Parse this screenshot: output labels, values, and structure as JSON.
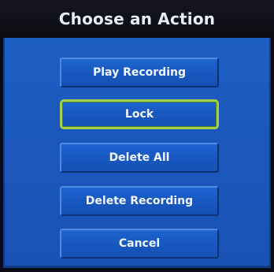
{
  "dialog": {
    "title": "Choose an Action"
  },
  "actions": [
    {
      "label": "Play Recording"
    },
    {
      "label": "Lock",
      "focused": true
    },
    {
      "label": "Delete All"
    },
    {
      "label": "Delete Recording"
    },
    {
      "label": "Cancel"
    }
  ],
  "colors": {
    "panel": "#1b57bb",
    "titlebar": "#0b0b12",
    "focus_outline": "#9fd24a",
    "button_text": "#f2f6ff"
  }
}
